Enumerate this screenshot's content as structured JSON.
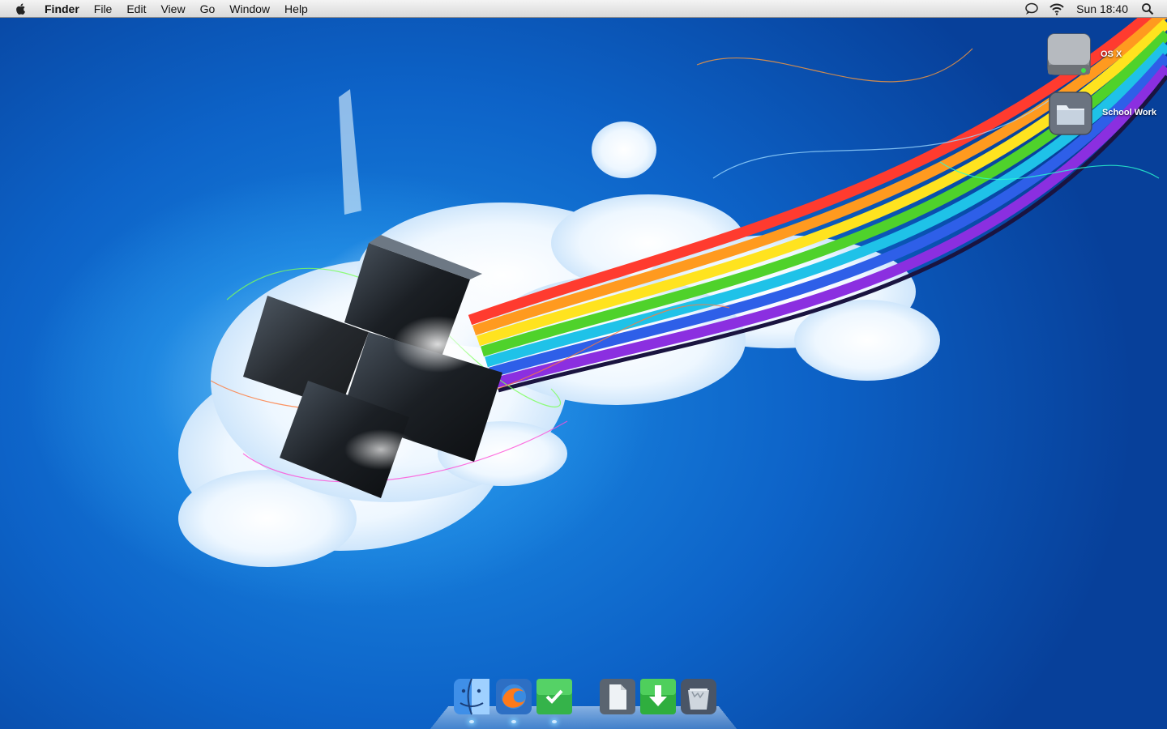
{
  "menubar": {
    "apple_icon": "apple-logo",
    "app_name": "Finder",
    "menus": [
      "File",
      "Edit",
      "View",
      "Go",
      "Window",
      "Help"
    ],
    "extras": [
      "chat-bubble-icon",
      "wifi-icon"
    ],
    "clock": "Sun 18:40",
    "spotlight_icon": "magnifier-icon"
  },
  "desktop": {
    "icons": [
      {
        "label": "OS X",
        "icon": "hard-drive-icon"
      },
      {
        "label": "School Work",
        "icon": "folder-icon"
      }
    ]
  },
  "dock": {
    "items": [
      {
        "name": "Finder",
        "icon": "finder-icon",
        "running": true
      },
      {
        "name": "Firefox",
        "icon": "firefox-icon",
        "running": true
      },
      {
        "name": "Tasks",
        "icon": "checkmark-icon",
        "running": true
      },
      {
        "name": "Documents",
        "icon": "document-icon",
        "running": false
      },
      {
        "name": "Downloads",
        "icon": "download-arrow-icon",
        "running": false
      },
      {
        "name": "Trash",
        "icon": "trash-icon",
        "running": false
      }
    ]
  },
  "colors": {
    "sky_deep": "#07409a",
    "sky_mid": "#1d8fe6",
    "rainbow": [
      "#ff3b2f",
      "#ff9a1f",
      "#ffe31f",
      "#4fd22b",
      "#1fc2e8",
      "#2e5fe8",
      "#8b2fe0"
    ]
  }
}
